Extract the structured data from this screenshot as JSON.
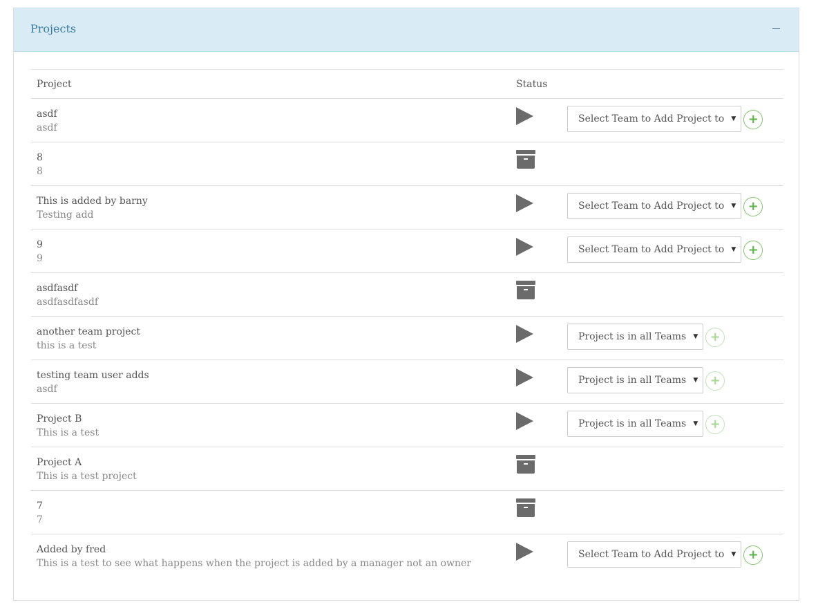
{
  "panel": {
    "title": "Projects",
    "toggle_label": "–"
  },
  "table": {
    "headers": {
      "project": "Project",
      "status": "Status"
    },
    "rows": [
      {
        "name": "asdf",
        "description": "asdf",
        "status": "active",
        "select_label": "Select Team to Add Project to",
        "add_enabled": true
      },
      {
        "name": "8",
        "description": "8",
        "status": "archived"
      },
      {
        "name": "This is added by barny",
        "description": "Testing add",
        "status": "active",
        "select_label": "Select Team to Add Project to",
        "add_enabled": true
      },
      {
        "name": "9",
        "description": "9",
        "status": "active",
        "select_label": "Select Team to Add Project to",
        "add_enabled": true
      },
      {
        "name": "asdfasdf",
        "description": "asdfasdfasdf",
        "status": "archived"
      },
      {
        "name": "another team project",
        "description": "this is a test",
        "status": "active",
        "select_label": "Project is in all Teams",
        "add_enabled": false
      },
      {
        "name": "testing team user adds",
        "description": "asdf",
        "status": "active",
        "select_label": "Project is in all Teams",
        "add_enabled": false
      },
      {
        "name": "Project B",
        "description": "This is a test",
        "status": "active",
        "select_label": "Project is in all Teams",
        "add_enabled": false
      },
      {
        "name": "Project A",
        "description": "This is a test project",
        "status": "archived"
      },
      {
        "name": "7",
        "description": "7",
        "status": "archived"
      },
      {
        "name": "Added by fred",
        "description": "This is a test to see what happens when the project is added by a manager not an owner",
        "status": "active",
        "select_label": "Select Team to Add Project to",
        "add_enabled": true
      }
    ]
  },
  "icons": {
    "active": "play-icon",
    "archived": "archive-icon",
    "add": "plus-circle-icon",
    "select_caret": "caret-down-icon"
  },
  "colors": {
    "heading_bg": "#d9ebf5",
    "title": "#3b7ba4",
    "add_green": "#5bb545",
    "icon_gray": "#6b6b6b"
  }
}
